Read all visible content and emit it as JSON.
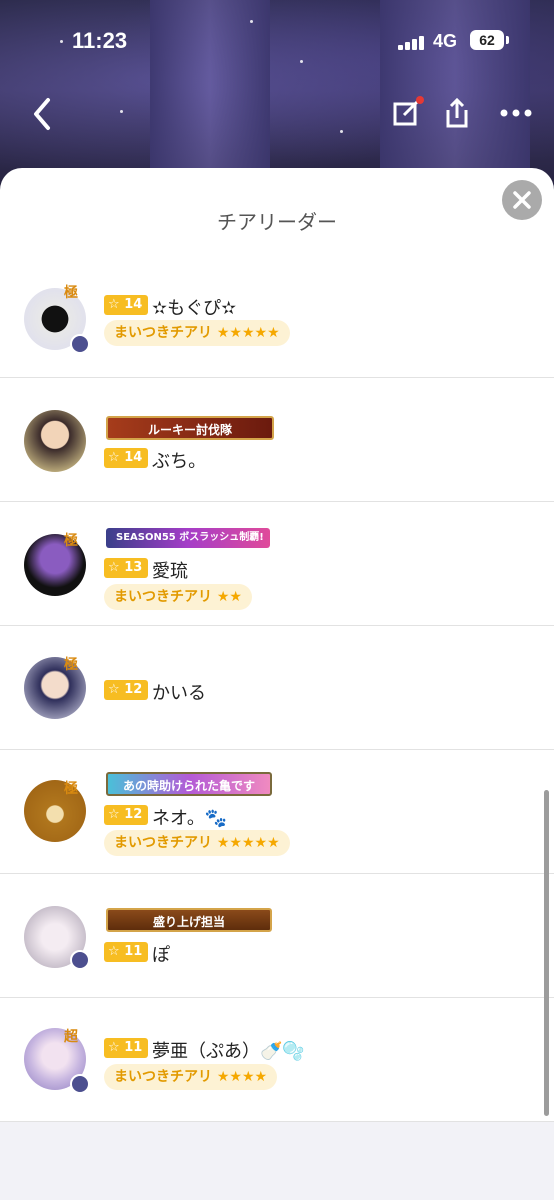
{
  "status_bar": {
    "time": "11:23",
    "network": "4G",
    "battery": "62"
  },
  "nav": {
    "back_icon": "chevron-left-icon",
    "edit_icon": "compose-icon",
    "share_icon": "share-icon",
    "more_icon": "ellipsis-icon"
  },
  "sheet": {
    "title": "チアリーダー",
    "close_icon": "close-icon"
  },
  "members": [
    {
      "level": "14",
      "name": "✫もぐぴ✫",
      "rank_mark": "極",
      "banner": "",
      "tag": "まいつきチアリ",
      "tag_stars": 5
    },
    {
      "level": "14",
      "name": "ぶち。",
      "rank_mark": "",
      "banner": "ルーキー討伐隊",
      "tag": "",
      "tag_stars": 0
    },
    {
      "level": "13",
      "name": "愛琉",
      "rank_mark": "極",
      "banner": "SEASON55 ボスラッシュ制覇!",
      "tag": "まいつきチアリ",
      "tag_stars": 2
    },
    {
      "level": "12",
      "name": "かいる",
      "rank_mark": "極",
      "banner": "",
      "tag": "",
      "tag_stars": 0
    },
    {
      "level": "12",
      "name": "ネオ。🐾",
      "rank_mark": "極",
      "banner": "あの時助けられた亀です",
      "tag": "まいつきチアリ",
      "tag_stars": 5
    },
    {
      "level": "11",
      "name": "ぽ",
      "rank_mark": "",
      "banner": "盛り上げ担当",
      "tag": "",
      "tag_stars": 0
    },
    {
      "level": "11",
      "name": "夢亜（ぷあ）🍼🫧",
      "rank_mark": "超",
      "banner": "",
      "tag": "まいつきチアリ",
      "tag_stars": 4
    }
  ],
  "colors": {
    "level_badge": "#f7bd22",
    "tag_bg": "#fdf2d4",
    "tag_text": "#e29a00"
  }
}
